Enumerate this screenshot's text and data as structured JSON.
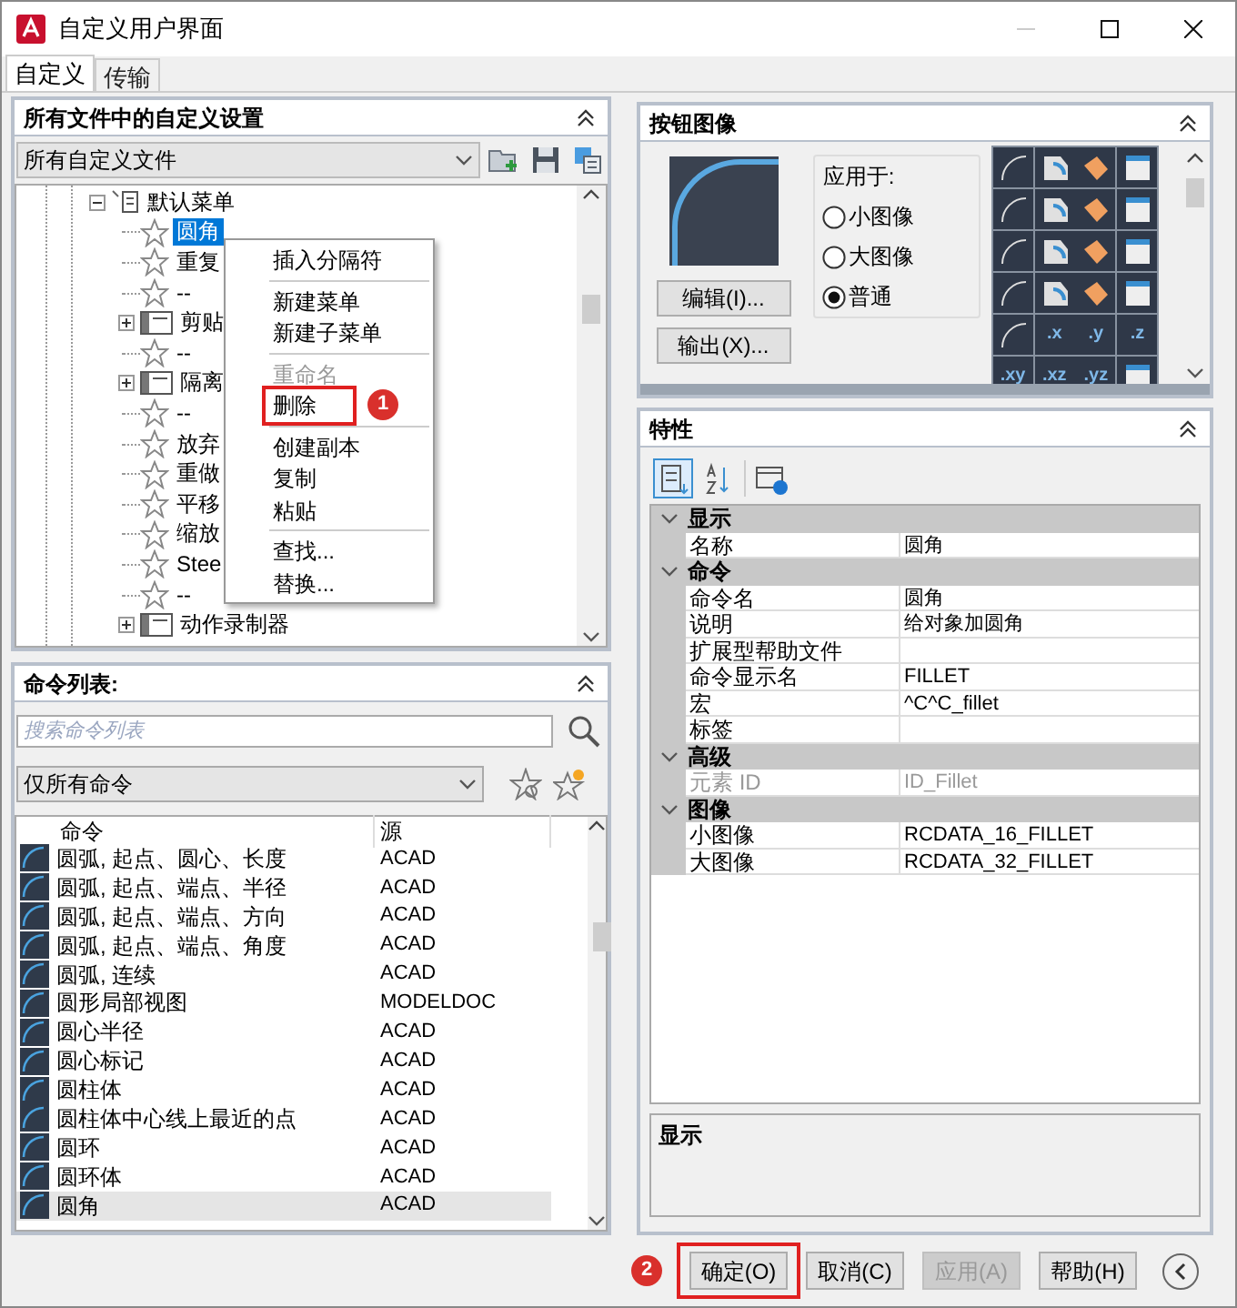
{
  "window": {
    "title": "自定义用户界面"
  },
  "tabs": [
    {
      "label": "自定义",
      "selected": true
    },
    {
      "label": "传输",
      "selected": false
    }
  ],
  "customizations_panel": {
    "title": "所有文件中的自定义设置",
    "file_dropdown": "所有自定义文件",
    "tree": [
      {
        "label": "默认菜单",
        "kind": "menu",
        "expanded": true,
        "children": [
          {
            "label": "圆角",
            "kind": "command",
            "selected": true
          },
          {
            "label": "重复",
            "kind": "command",
            "selected": false
          },
          {
            "label": "--",
            "kind": "command",
            "selected": false
          },
          {
            "label": "剪贴",
            "kind": "submenu",
            "expanded": false,
            "selected": false
          },
          {
            "label": "--",
            "kind": "command",
            "selected": false
          },
          {
            "label": "隔离",
            "kind": "submenu",
            "expanded": false,
            "selected": false
          },
          {
            "label": "--",
            "kind": "command",
            "selected": false
          },
          {
            "label": "放弃",
            "kind": "command",
            "selected": false
          },
          {
            "label": "重做",
            "kind": "command",
            "selected": false
          },
          {
            "label": "平移",
            "kind": "command",
            "selected": false
          },
          {
            "label": "缩放",
            "kind": "command",
            "selected": false
          },
          {
            "label": "Stee",
            "kind": "command",
            "selected": false
          },
          {
            "label": "--",
            "kind": "command",
            "selected": false
          },
          {
            "label": "动作录制器",
            "kind": "submenu",
            "expanded": false,
            "selected": false
          }
        ]
      }
    ],
    "context_menu": [
      [
        {
          "label": "插入分隔符",
          "disabled": false
        }
      ],
      [
        {
          "label": "新建菜单",
          "disabled": false
        },
        {
          "label": "新建子菜单",
          "disabled": false
        }
      ],
      [
        {
          "label": "重命名",
          "disabled": true
        },
        {
          "label": "删除",
          "disabled": false,
          "callout": "1"
        }
      ],
      [
        {
          "label": "创建副本",
          "disabled": false
        },
        {
          "label": "复制",
          "disabled": false
        },
        {
          "label": "粘贴",
          "disabled": false
        }
      ],
      [
        {
          "label": "查找...",
          "disabled": false
        },
        {
          "label": "替换...",
          "disabled": false
        }
      ]
    ]
  },
  "command_list": {
    "title": "命令列表:",
    "search": {
      "placeholder": "搜索命令列表"
    },
    "filter": "仅所有命令",
    "columns": [
      "命令",
      "源"
    ],
    "rows": [
      {
        "command": "圆弧, 起点、圆心、长度",
        "source": "ACAD",
        "selected": false
      },
      {
        "command": "圆弧, 起点、端点、半径",
        "source": "ACAD",
        "selected": false
      },
      {
        "command": "圆弧, 起点、端点、方向",
        "source": "ACAD",
        "selected": false
      },
      {
        "command": "圆弧, 起点、端点、角度",
        "source": "ACAD",
        "selected": false
      },
      {
        "command": "圆弧, 连续",
        "source": "ACAD",
        "selected": false
      },
      {
        "command": "圆形局部视图",
        "source": "MODELDOC",
        "selected": false
      },
      {
        "command": "圆心半径",
        "source": "ACAD",
        "selected": false
      },
      {
        "command": "圆心标记",
        "source": "ACAD",
        "selected": false
      },
      {
        "command": "圆柱体",
        "source": "ACAD",
        "selected": false
      },
      {
        "command": "圆柱体中心线上最近的点",
        "source": "ACAD",
        "selected": false
      },
      {
        "command": "圆环",
        "source": "ACAD",
        "selected": false
      },
      {
        "command": "圆环体",
        "source": "ACAD",
        "selected": false
      },
      {
        "command": "圆角",
        "source": "ACAD",
        "selected": true
      }
    ]
  },
  "button_image": {
    "title": "按钮图像",
    "apply_to_label": "应用于:",
    "apply_to": [
      {
        "label": "小图像",
        "selected": false
      },
      {
        "label": "大图像",
        "selected": false
      },
      {
        "label": "普通",
        "selected": true
      }
    ],
    "buttons": [
      "编辑(I)...",
      "输出(X)..."
    ],
    "icon_grid": [
      {
        "kind": "icon"
      },
      {
        "kind": "icon"
      },
      {
        "kind": "icon"
      },
      {
        "kind": "icon"
      },
      {
        "kind": "icon"
      },
      {
        "kind": "icon"
      },
      {
        "kind": "icon"
      },
      {
        "kind": "icon"
      },
      {
        "kind": "icon"
      },
      {
        "kind": "icon"
      },
      {
        "kind": "icon"
      },
      {
        "kind": "icon"
      },
      {
        "kind": "icon"
      },
      {
        "kind": "icon"
      },
      {
        "kind": "icon"
      },
      {
        "kind": "icon"
      },
      {
        "kind": "icon"
      },
      {
        "kind": "label",
        "text": ".x"
      },
      {
        "kind": "label",
        "text": ".y"
      },
      {
        "kind": "label",
        "text": ".z"
      },
      {
        "kind": "label",
        "text": ".xy"
      },
      {
        "kind": "label",
        "text": ".xz"
      },
      {
        "kind": "label",
        "text": ".yz"
      },
      {
        "kind": "icon"
      }
    ]
  },
  "properties": {
    "title": "特性",
    "toolbar": [
      {
        "kind": "categorized",
        "selected": true
      },
      {
        "kind": "alphabetical",
        "selected": false
      },
      {
        "kind": "info",
        "selected": false
      }
    ],
    "categories": [
      {
        "name": "显示",
        "expanded": true,
        "rows": [
          {
            "name": "名称",
            "value": "圆角",
            "disabled": false
          }
        ]
      },
      {
        "name": "命令",
        "expanded": true,
        "rows": [
          {
            "name": "命令名",
            "value": "圆角",
            "disabled": false
          },
          {
            "name": "说明",
            "value": "给对象加圆角",
            "disabled": false
          },
          {
            "name": "扩展型帮助文件",
            "disabled": false
          },
          {
            "name": "命令显示名",
            "value": "FILLET",
            "disabled": false
          },
          {
            "name": "宏",
            "value": "^C^C_fillet",
            "disabled": false
          },
          {
            "name": "标签",
            "disabled": false
          }
        ]
      },
      {
        "name": "高级",
        "expanded": true,
        "rows": [
          {
            "name": "元素 ID",
            "value": "ID_Fillet",
            "disabled": true
          }
        ]
      },
      {
        "name": "图像",
        "expanded": true,
        "rows": [
          {
            "name": "小图像",
            "value": "RCDATA_16_FILLET",
            "disabled": false
          },
          {
            "name": "大图像",
            "value": "RCDATA_32_FILLET",
            "disabled": false
          }
        ]
      }
    ],
    "description_title": "显示"
  },
  "footer_buttons": [
    {
      "label": "确定(O)",
      "disabled": false,
      "callout": "2"
    },
    {
      "label": "取消(C)",
      "disabled": false
    },
    {
      "label": "应用(A)",
      "disabled": true
    },
    {
      "label": "帮助(H)",
      "disabled": false
    }
  ]
}
